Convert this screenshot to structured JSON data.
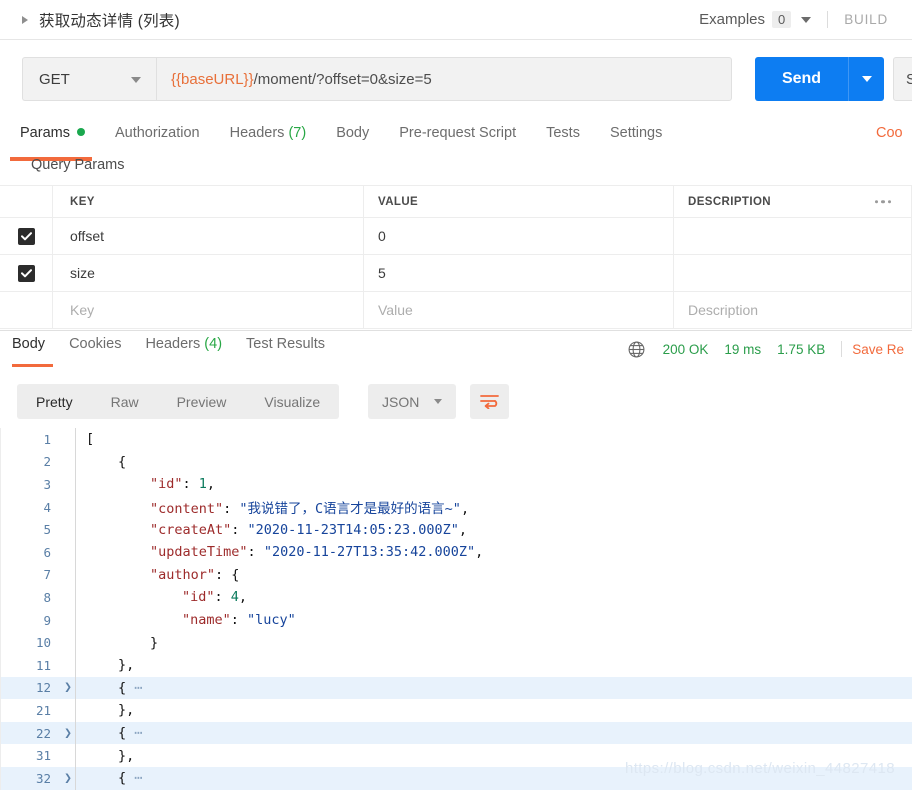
{
  "request_header": {
    "title": "获取动态详情 (列表)",
    "collapse_icon": "triangle-right-icon",
    "examples_label": "Examples",
    "examples_count": "0",
    "examples_caret": "chevron-down-icon",
    "build_label": "BUILD"
  },
  "url_bar": {
    "method": "GET",
    "method_caret": "chevron-down-icon",
    "url_variable": "{{baseURL}}",
    "url_path": "/moment/?offset=0&size=5",
    "send_label": "Send",
    "send_caret": "chevron-down-icon",
    "save_label": "Save"
  },
  "request_tabs": {
    "items": [
      {
        "label": "Params",
        "active": true,
        "dot": true
      },
      {
        "label": "Authorization",
        "active": false
      },
      {
        "label": "Headers",
        "count": "(7)",
        "active": false
      },
      {
        "label": "Body",
        "active": false
      },
      {
        "label": "Pre-request Script",
        "active": false
      },
      {
        "label": "Tests",
        "active": false
      },
      {
        "label": "Settings",
        "active": false
      }
    ],
    "cookies_link": "Coo",
    "active_color": "#f26a3c",
    "dot_color": "#1aa84e"
  },
  "query_params": {
    "section_label": "Query Params",
    "columns": [
      "KEY",
      "VALUE",
      "DESCRIPTION"
    ],
    "overflow_icon": "ellipsis-icon",
    "rows": [
      {
        "checked": true,
        "key": "offset",
        "value": "0",
        "description": ""
      },
      {
        "checked": true,
        "key": "size",
        "value": "5",
        "description": ""
      }
    ],
    "placeholder_row": {
      "key": "Key",
      "value": "Value",
      "description": "Description"
    }
  },
  "response": {
    "tabs": [
      {
        "label": "Body",
        "active": true
      },
      {
        "label": "Cookies",
        "active": false
      },
      {
        "label": "Headers",
        "count": "(4)",
        "active": false
      },
      {
        "label": "Test Results",
        "active": false
      }
    ],
    "globe_icon": "globe-icon",
    "status": "200 OK",
    "time": "19 ms",
    "size": "1.75 KB",
    "save_response": "Save Re",
    "status_color": "#2a9d4a",
    "accent_color": "#f26a3c",
    "view_modes": [
      {
        "label": "Pretty",
        "active": true
      },
      {
        "label": "Raw",
        "active": false
      },
      {
        "label": "Preview",
        "active": false
      },
      {
        "label": "Visualize",
        "active": false
      }
    ],
    "language": "JSON",
    "language_caret": "chevron-down-icon",
    "wrap_icon": "word-wrap-icon"
  },
  "code": {
    "lines": [
      {
        "num": "1",
        "indent": 0,
        "collapsed": false,
        "highlight": false,
        "tokens": [
          {
            "t": "p",
            "v": "["
          }
        ]
      },
      {
        "num": "2",
        "indent": 1,
        "collapsed": false,
        "highlight": false,
        "tokens": [
          {
            "t": "p",
            "v": "{"
          }
        ]
      },
      {
        "num": "3",
        "indent": 2,
        "collapsed": false,
        "highlight": false,
        "tokens": [
          {
            "t": "k",
            "v": "\"id\""
          },
          {
            "t": "p",
            "v": ": "
          },
          {
            "t": "n",
            "v": "1"
          },
          {
            "t": "p",
            "v": ","
          }
        ]
      },
      {
        "num": "4",
        "indent": 2,
        "collapsed": false,
        "highlight": false,
        "tokens": [
          {
            "t": "k",
            "v": "\"content\""
          },
          {
            "t": "p",
            "v": ": "
          },
          {
            "t": "s",
            "v": "\"我说错了，C语言才是最好的语言~\""
          },
          {
            "t": "p",
            "v": ","
          }
        ]
      },
      {
        "num": "5",
        "indent": 2,
        "collapsed": false,
        "highlight": false,
        "tokens": [
          {
            "t": "k",
            "v": "\"createAt\""
          },
          {
            "t": "p",
            "v": ": "
          },
          {
            "t": "s",
            "v": "\"2020-11-23T14:05:23.000Z\""
          },
          {
            "t": "p",
            "v": ","
          }
        ]
      },
      {
        "num": "6",
        "indent": 2,
        "collapsed": false,
        "highlight": false,
        "tokens": [
          {
            "t": "k",
            "v": "\"updateTime\""
          },
          {
            "t": "p",
            "v": ": "
          },
          {
            "t": "s",
            "v": "\"2020-11-27T13:35:42.000Z\""
          },
          {
            "t": "p",
            "v": ","
          }
        ]
      },
      {
        "num": "7",
        "indent": 2,
        "collapsed": false,
        "highlight": false,
        "tokens": [
          {
            "t": "k",
            "v": "\"author\""
          },
          {
            "t": "p",
            "v": ": {"
          }
        ]
      },
      {
        "num": "8",
        "indent": 3,
        "collapsed": false,
        "highlight": false,
        "tokens": [
          {
            "t": "k",
            "v": "\"id\""
          },
          {
            "t": "p",
            "v": ": "
          },
          {
            "t": "n",
            "v": "4"
          },
          {
            "t": "p",
            "v": ","
          }
        ]
      },
      {
        "num": "9",
        "indent": 3,
        "collapsed": false,
        "highlight": false,
        "tokens": [
          {
            "t": "k",
            "v": "\"name\""
          },
          {
            "t": "p",
            "v": ": "
          },
          {
            "t": "s",
            "v": "\"lucy\""
          }
        ]
      },
      {
        "num": "10",
        "indent": 2,
        "collapsed": false,
        "highlight": false,
        "tokens": [
          {
            "t": "p",
            "v": "}"
          }
        ]
      },
      {
        "num": "11",
        "indent": 1,
        "collapsed": false,
        "highlight": false,
        "tokens": [
          {
            "t": "p",
            "v": "},"
          }
        ]
      },
      {
        "num": "12",
        "indent": 1,
        "collapsed": true,
        "highlight": true,
        "tokens": [
          {
            "t": "p",
            "v": "{"
          },
          {
            "t": "dots3",
            "v": " ⋯"
          }
        ]
      },
      {
        "num": "21",
        "indent": 1,
        "collapsed": false,
        "highlight": false,
        "tokens": [
          {
            "t": "p",
            "v": "},"
          }
        ]
      },
      {
        "num": "22",
        "indent": 1,
        "collapsed": true,
        "highlight": true,
        "tokens": [
          {
            "t": "p",
            "v": "{"
          },
          {
            "t": "dots3",
            "v": " ⋯"
          }
        ]
      },
      {
        "num": "31",
        "indent": 1,
        "collapsed": false,
        "highlight": false,
        "tokens": [
          {
            "t": "p",
            "v": "},"
          }
        ]
      },
      {
        "num": "32",
        "indent": 1,
        "collapsed": true,
        "highlight": true,
        "tokens": [
          {
            "t": "p",
            "v": "{"
          },
          {
            "t": "dots3",
            "v": " ⋯"
          }
        ]
      }
    ]
  },
  "watermark": "https://blog.csdn.net/weixin_44827418"
}
